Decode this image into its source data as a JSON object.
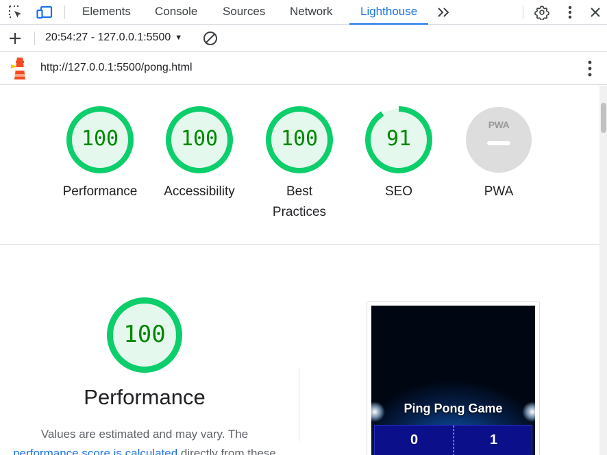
{
  "devtools": {
    "tabs": [
      "Elements",
      "Console",
      "Sources",
      "Network",
      "Lighthouse"
    ],
    "active_tab": "Lighthouse"
  },
  "toolbar": {
    "report_label": "20:54:27 - 127.0.0.1:5500"
  },
  "urlbar": {
    "url": "http://127.0.0.1:5500/pong.html"
  },
  "scores": [
    {
      "label": "Performance",
      "value": "100",
      "score": 100,
      "color": "#0cce6b"
    },
    {
      "label": "Accessibility",
      "value": "100",
      "score": 100,
      "color": "#0cce6b"
    },
    {
      "label": "Best Practices",
      "value": "100",
      "score": 100,
      "color": "#0cce6b"
    },
    {
      "label": "SEO",
      "value": "91",
      "score": 91,
      "color": "#0cce6b"
    },
    {
      "label": "PWA",
      "value": "",
      "score": null,
      "color": "#c0c0c0"
    }
  ],
  "pwa_badge": "PWA",
  "performance": {
    "score": "100",
    "title": "Performance",
    "desc_line1": "Values are estimated and may vary. The",
    "desc_link": "performance score is calculated",
    "desc_line2_rest": " directly from these"
  },
  "screenshot": {
    "title": "Ping Pong Game",
    "score_left": "0",
    "score_right": "1"
  },
  "colors": {
    "accent": "#1a73e8",
    "pass": "#0cce6b",
    "pass_text": "#008800",
    "pass_fill": "#e5f8ed"
  }
}
